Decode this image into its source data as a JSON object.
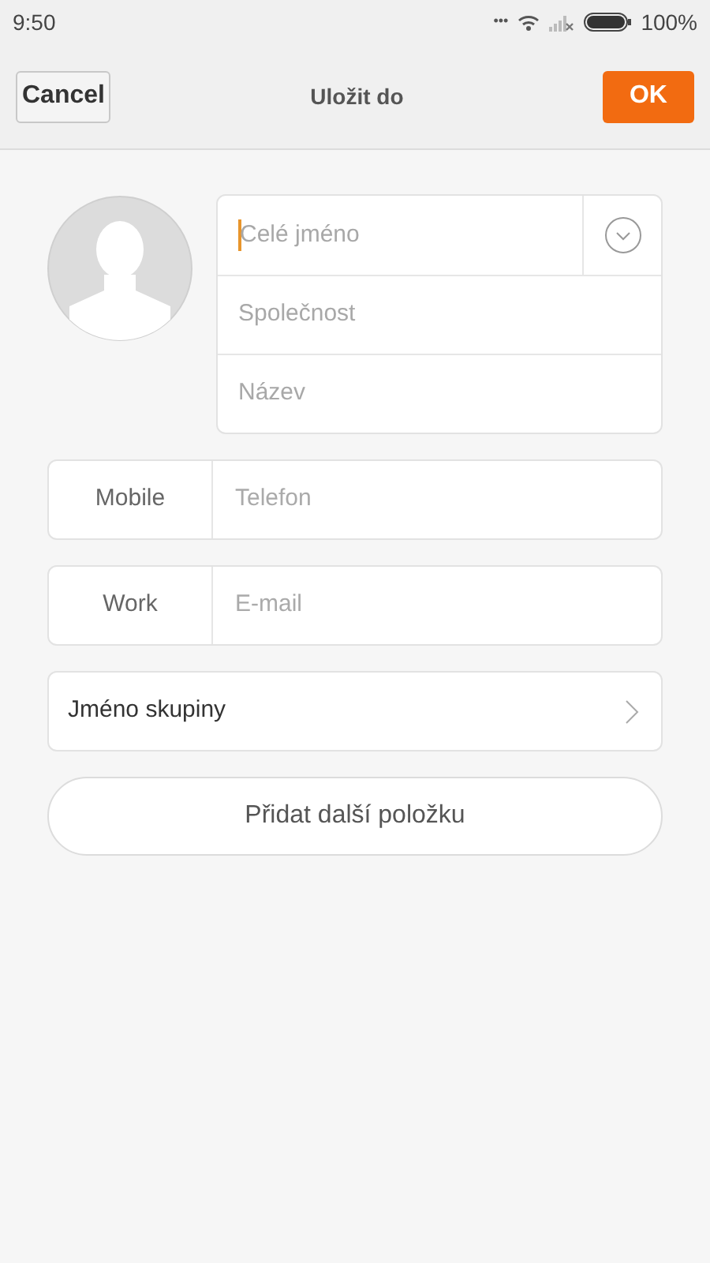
{
  "status_bar": {
    "time": "9:50",
    "dots": "•••",
    "battery": "100%"
  },
  "header": {
    "cancel": "Cancel",
    "title": "Uložit do",
    "ok": "OK"
  },
  "name_fields": [
    {
      "placeholder": "Celé jméno",
      "focused": true
    },
    {
      "placeholder": "Společnost",
      "focused": false
    },
    {
      "placeholder": "Název",
      "focused": false
    }
  ],
  "contact_fields": [
    {
      "type": "Mobile",
      "placeholder": "Telefon"
    },
    {
      "type": "Work",
      "placeholder": "E-mail"
    }
  ],
  "group": {
    "label": "Jméno skupiny"
  },
  "add_button": "Přidat další položku"
}
